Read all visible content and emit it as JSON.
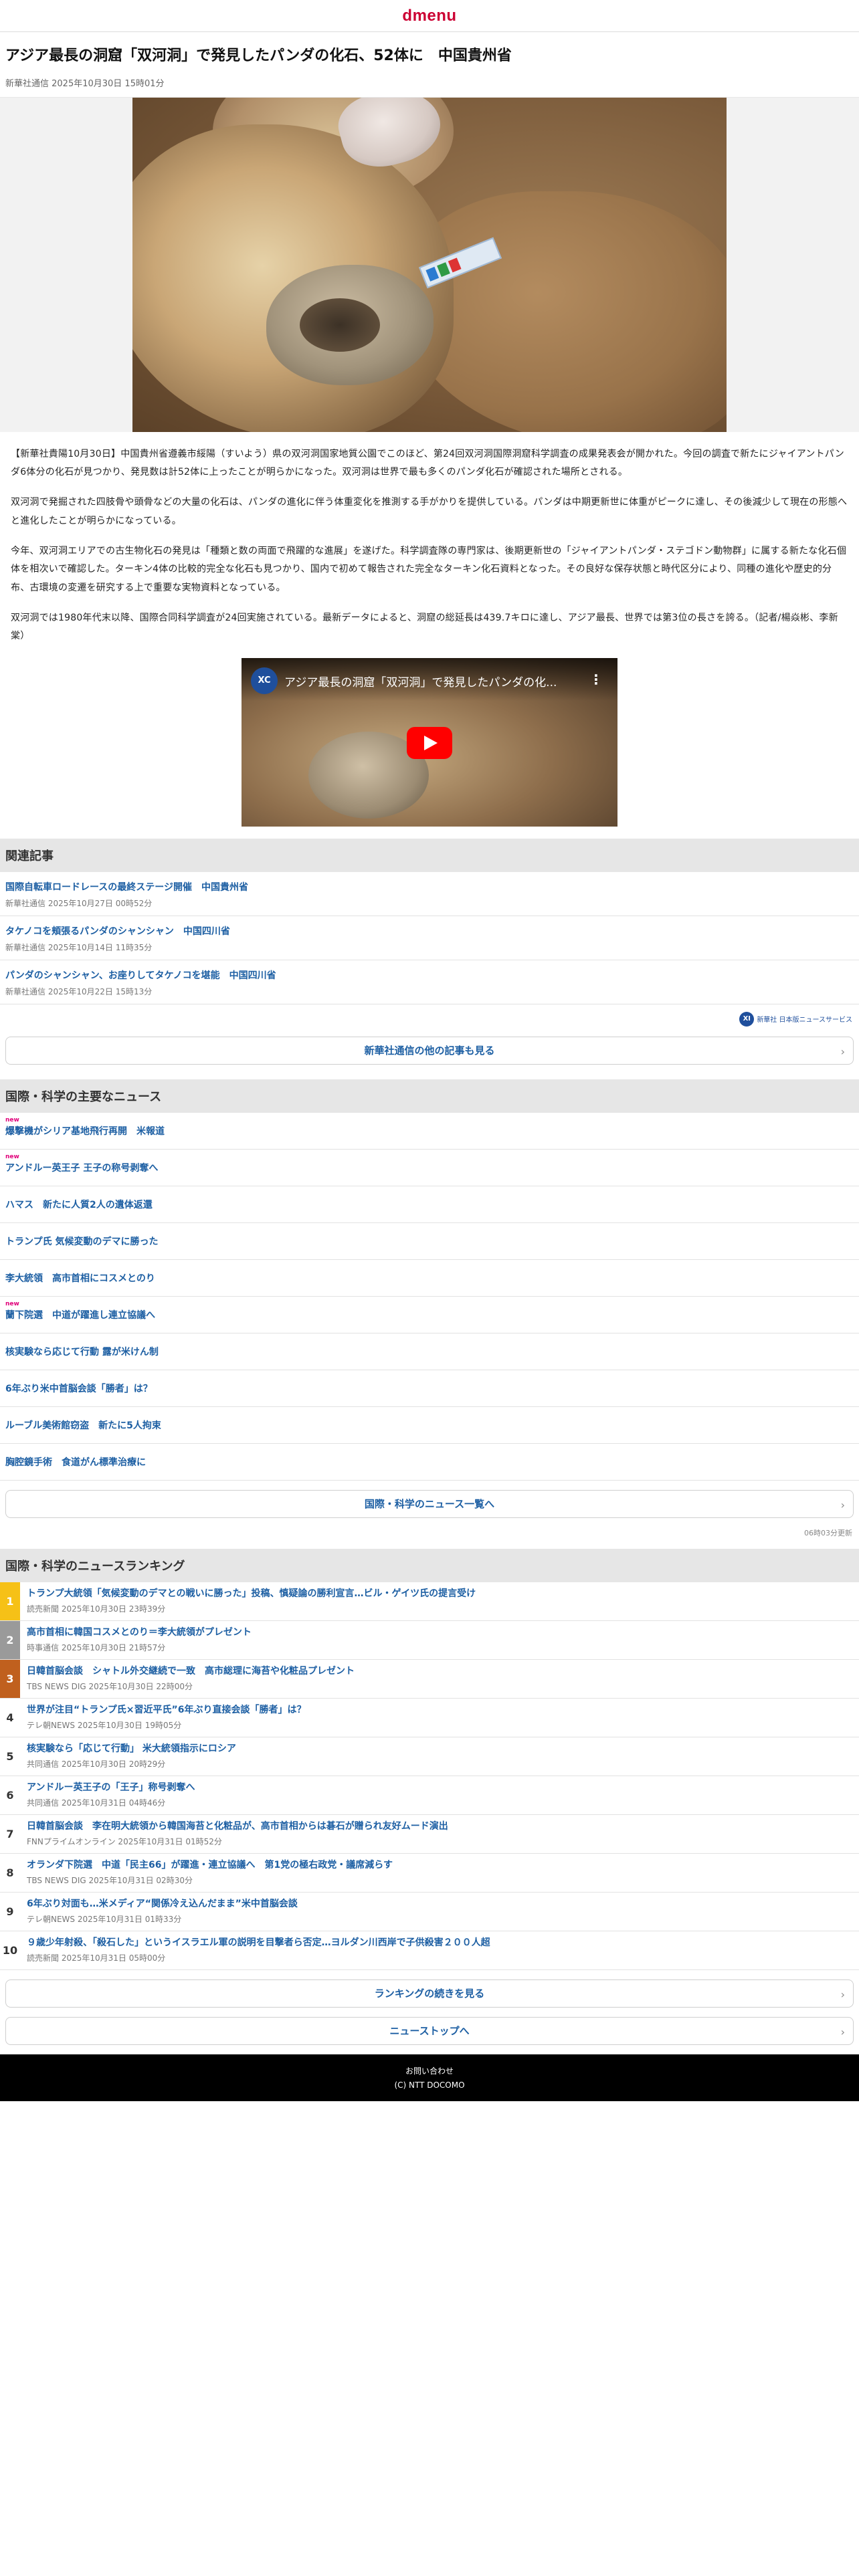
{
  "header": {
    "logo_d": "d",
    "logo_menu": "menu"
  },
  "article": {
    "title": "アジア最長の洞窟「双河洞」で発見したパンダの化石、52体に　中国貴州省",
    "meta": "新華社通信 2025年10月30日 15時01分",
    "paragraphs": [
      "【新華社貴陽10月30日】中国貴州省遵義市綏陽（すいよう）県の双河洞国家地質公園でこのほど、第24回双河洞国際洞窟科学調査の成果発表会が開かれた。今回の調査で新たにジャイアントパンダ6体分の化石が見つかり、発見数は計52体に上ったことが明らかになった。双河洞は世界で最も多くのパンダ化石が確認された場所とされる。",
      "双河洞で発掘された四肢骨や頭骨などの大量の化石は、パンダの進化に伴う体重変化を推測する手がかりを提供している。パンダは中期更新世に体重がピークに達し、その後減少して現在の形態へと進化したことが明らかになっている。",
      "今年、双河洞エリアでの古生物化石の発見は「種類と数の両面で飛躍的な進展」を遂げた。科学調査隊の専門家は、後期更新世の「ジャイアントパンダ・ステゴドン動物群」に属する新たな化石個体を相次いで確認した。ターキン4体の比較的完全な化石も見つかり、国内で初めて報告された完全なターキン化石資料となった。その良好な保存状態と時代区分により、同種の進化や歴史的分布、古環境の変遷を研究する上で重要な実物資料となっている。",
      "双河洞では1980年代末以降、国際合同科学調査が24回実施されている。最新データによると、洞窟の総延長は439.7キロに達し、アジア最長、世界では第3位の長さを誇る。（記者/楊焱彬、李新棠）"
    ],
    "video": {
      "channel_icon": "XC",
      "title": "アジア最長の洞窟「双河洞」で発見したパンダの化...",
      "menu_glyph": "⋮"
    }
  },
  "related": {
    "heading": "関連記事",
    "items": [
      {
        "title": "国際自転車ロードレースの最終ステージ開催　中国貴州省",
        "meta": "新華社通信 2025年10月27日 00時52分"
      },
      {
        "title": "タケノコを頬張るパンダのシャンシャン　中国四川省",
        "meta": "新華社通信 2025年10月14日 11時35分"
      },
      {
        "title": "パンダのシャンシャン、お座りしてタケノコを堪能　中国四川省",
        "meta": "新華社通信 2025年10月22日 15時13分"
      }
    ],
    "credit_mark": "XI",
    "credit_text": "新華社 日本版ニュースサービス",
    "more_label": "新華社通信の他の記事も見る"
  },
  "major": {
    "heading": "国際・科学の主要なニュース",
    "new_label": "new",
    "items": [
      {
        "title": "爆撃機がシリア基地飛行再開　米報道",
        "is_new": true
      },
      {
        "title": "アンドルー英王子 王子の称号剥奪へ",
        "is_new": true
      },
      {
        "title": "ハマス　新たに人質2人の遺体返還",
        "is_new": false
      },
      {
        "title": "トランプ氏 気候変動のデマに勝った",
        "is_new": false
      },
      {
        "title": "李大統領　高市首相にコスメとのり",
        "is_new": false
      },
      {
        "title": "蘭下院選　中道が躍進し連立協議へ",
        "is_new": true
      },
      {
        "title": "核実験なら応じて行動 露が米けん制",
        "is_new": false
      },
      {
        "title": "6年ぶり米中首脳会談「勝者」は？",
        "is_new": false
      },
      {
        "title": "ルーブル美術館窃盗　新たに5人拘束",
        "is_new": false
      },
      {
        "title": "胸腔鏡手術　食道がん標準治療に",
        "is_new": false
      }
    ],
    "more_label": "国際・科学のニュース一覧へ",
    "update_note": "06時03分更新"
  },
  "ranking": {
    "heading": "国際・科学のニュースランキング",
    "items": [
      {
        "num": "1",
        "title": "トランプ大統領「気候変動のデマとの戦いに勝った」投稿、慎疑論の勝利宣言…ビル・ゲイツ氏の提言受け",
        "meta": "読売新聞 2025年10月30日 23時39分"
      },
      {
        "num": "2",
        "title": "高市首相に韓国コスメとのり＝李大統領がプレゼント",
        "meta": "時事通信 2025年10月30日 21時57分"
      },
      {
        "num": "3",
        "title": "日韓首脳会談　シャトル外交継続で一致　高市総理に海苔や化粧品プレゼント",
        "meta": "TBS NEWS DIG 2025年10月30日 22時00分"
      },
      {
        "num": "4",
        "title": "世界が注目“トランプ氏×習近平氏”6年ぶり直接会談「勝者」は？",
        "meta": "テレ朝NEWS 2025年10月30日 19時05分"
      },
      {
        "num": "5",
        "title": "核実験なら「応じて行動」 米大統領指示にロシア",
        "meta": "共同通信 2025年10月30日 20時29分"
      },
      {
        "num": "6",
        "title": "アンドルー英王子の「王子」称号剥奪へ",
        "meta": "共同通信 2025年10月31日 04時46分"
      },
      {
        "num": "7",
        "title": "日韓首脳会談　李在明大統領から韓国海苔と化粧品が、高市首相からは碁石が贈られ友好ムード演出",
        "meta": "FNNプライムオンライン 2025年10月31日 01時52分"
      },
      {
        "num": "8",
        "title": "オランダ下院選　中道「民主66」が躍進・連立協議へ　第1党の極右政党・議席減らす",
        "meta": "TBS NEWS DIG 2025年10月31日 02時30分"
      },
      {
        "num": "9",
        "title": "6年ぶり対面も…米メディア“関係冷え込んだまま”米中首脳会談",
        "meta": "テレ朝NEWS 2025年10月31日 01時33分"
      },
      {
        "num": "10",
        "title": "９歳少年射殺、「殺石した」というイスラエル軍の説明を目撃者ら否定…ヨルダン川西岸で子供殺害２００人超",
        "meta": "読売新聞 2025年10月31日 05時00分"
      }
    ],
    "more_label": "ランキングの続きを見る",
    "top_label": "ニューストップへ"
  },
  "footer": {
    "contact": "お問い合わせ",
    "copyright": "(C) NTT DOCOMO"
  },
  "colors": {
    "link": "#1d5fa3",
    "brand": "#cc0033",
    "new_badge": "#e0007a",
    "rank1": "#f6c117",
    "rank2": "#9a9a9a",
    "rank3": "#c0601e"
  }
}
